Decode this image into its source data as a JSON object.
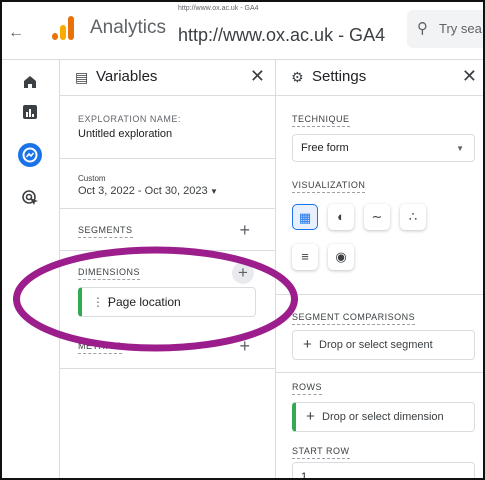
{
  "topbar": {
    "back_icon": "arrow-left-icon",
    "app_title": "Analytics",
    "url_small": "http://www.ox.ac.uk - GA4",
    "url_large": "http://www.ox.ac.uk - GA4",
    "search_placeholder": "Try sea",
    "brand_colors": {
      "orange": "#e8710a",
      "yellow": "#f9ab00"
    }
  },
  "rail": {
    "items": [
      {
        "icon": "home-icon"
      },
      {
        "icon": "reports-icon"
      },
      {
        "icon": "explore-icon",
        "active": true,
        "color": "#1a73e8"
      },
      {
        "icon": "advertising-icon"
      }
    ]
  },
  "variables": {
    "title": "Variables",
    "close_icon": "close-icon",
    "exploration_name_label": "EXPLORATION NAME:",
    "exploration_name": "Untitled exploration",
    "custom_label": "Custom",
    "date_range": "Oct 3, 2022 - Oct 30, 2023",
    "segments_label": "SEGMENTS",
    "dimensions_label": "DIMENSIONS",
    "dimension_item": "Page location",
    "metrics_label": "METRICS",
    "add_symbol": "+",
    "dimension_accent": "#34a853"
  },
  "settings": {
    "title": "Settings",
    "technique_label": "TECHNIQUE",
    "technique_value": "Free form",
    "visualization_label": "VISUALIZATION",
    "visualization_options": [
      "table-icon",
      "donut-chart-icon",
      "line-chart-icon",
      "scatter-plot-icon",
      "bar-chart-icon",
      "geo-map-icon"
    ],
    "selected_visualization": "table-icon",
    "segment_comparisons_label": "SEGMENT COMPARISONS",
    "segment_drop_text": "Drop or select segment",
    "rows_label": "ROWS",
    "rows_drop_text": "Drop or select dimension",
    "start_row_label": "START ROW",
    "start_row_value": "1",
    "add_symbol": "+"
  },
  "annotation": {
    "shape": "ellipse",
    "color": "#9c1e8c"
  }
}
